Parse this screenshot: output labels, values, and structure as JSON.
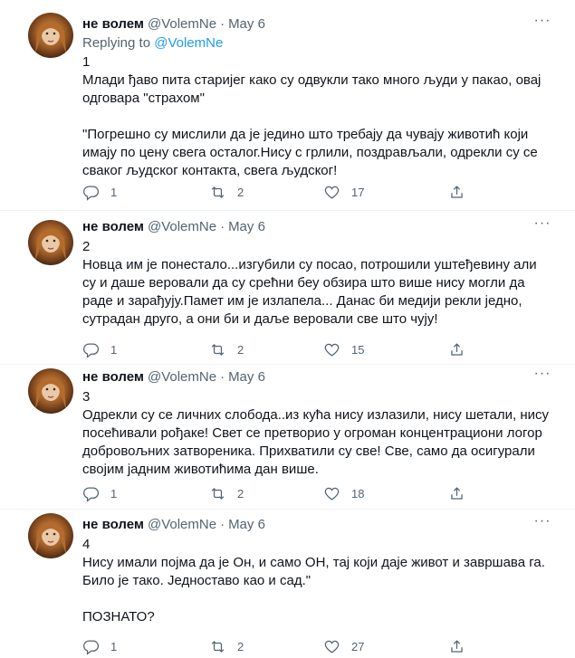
{
  "colors": {
    "accent": "#1d9bf0",
    "muted": "#536471",
    "text": "#0f1419",
    "divider": "#eff3f4"
  },
  "tweets": [
    {
      "name": "не волем",
      "handle": "@VolemNe",
      "dot": "·",
      "date": "May 6",
      "replying_prefix": "Replying to ",
      "replying_to": "@VolemNe",
      "body": "1\nМлади ђаво пита старијег како су одвукли тако много људи у пакао, овај одговара \"страхом\"\n\n\"Погрешно су мислили да је једино што требају да чувају животић који имају по цену свега осталог.Нису с грлили, поздрављали, одрекли су се сваког људског контакта, свега људског!",
      "replies": "1",
      "retweets": "2",
      "likes": "17"
    },
    {
      "name": "не волем",
      "handle": "@VolemNe",
      "dot": "·",
      "date": "May 6",
      "body": "2\nНовца им је понестало...изгубили су посао, потрошили уштеђевину али су и даше веровали да су срећни беу обзира што више нису могли да раде и зарађују.Памет им је излапела... Данас би медији рекли једно, сутрадан друго, а они би и даље веровали све што чују!",
      "replies": "1",
      "retweets": "2",
      "likes": "15"
    },
    {
      "name": "не волем",
      "handle": "@VolemNe",
      "dot": "·",
      "date": "May 6",
      "body": "3\nОдрекли су се личних слобода..из кућа нису излазили, нису шетали, нису посећивали рођаке! Свет се претворио у огроман концентрациони логор добровољних затвореника. Прихватили су све! Све, само да осигурали својим јадним животићима дан више.",
      "replies": "1",
      "retweets": "2",
      "likes": "18"
    },
    {
      "name": "не волем",
      "handle": "@VolemNe",
      "dot": "·",
      "date": "May 6",
      "body": "4\nНису имали појма да је Он, и само ОН, тај који даје живот и завршава га. Било је тако. Једноставо као и сад.\"\n\nПОЗНАТО?",
      "replies": "1",
      "retweets": "2",
      "likes": "27"
    }
  ]
}
